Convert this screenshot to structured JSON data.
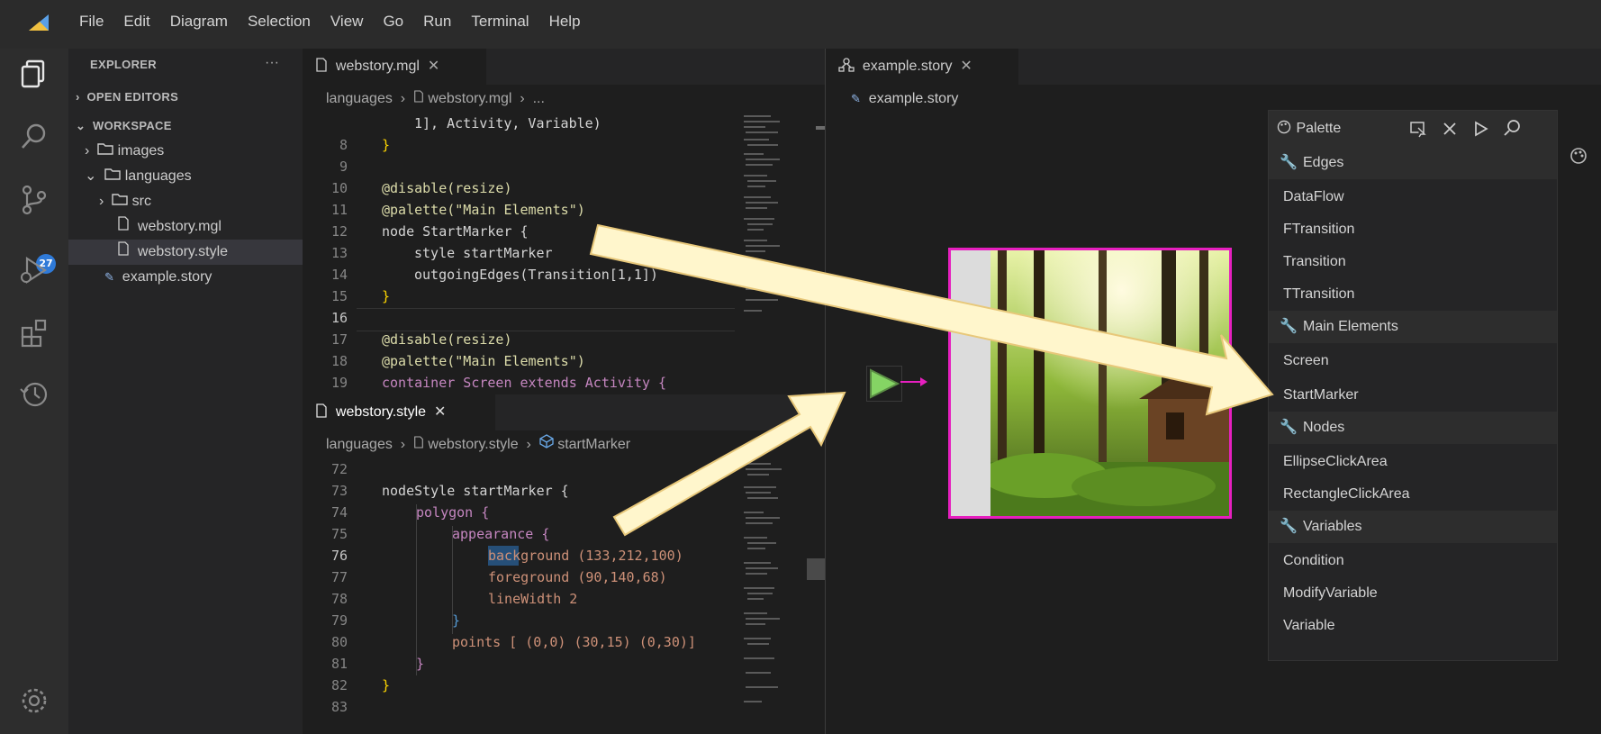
{
  "menu": [
    "File",
    "Edit",
    "Diagram",
    "Selection",
    "View",
    "Go",
    "Run",
    "Terminal",
    "Help"
  ],
  "activity_bar": {
    "scm_badge": "27"
  },
  "explorer": {
    "title": "EXPLORER",
    "more": "···",
    "open_editors": "OPEN EDITORS",
    "workspace": "WORKSPACE",
    "items": [
      {
        "label": "images"
      },
      {
        "label": "languages"
      },
      {
        "label": "src"
      },
      {
        "label": "webstory.mgl"
      },
      {
        "label": "webstory.style"
      },
      {
        "label": "example.story"
      }
    ]
  },
  "editor_top": {
    "tab": "webstory.mgl",
    "breadcrumb": {
      "a": "languages",
      "b": "webstory.mgl",
      "c": "..."
    },
    "lines": [
      {
        "n": "",
        "text": "1], Activity, Variable)"
      },
      {
        "n": "8",
        "text": "}"
      },
      {
        "n": "9",
        "text": ""
      },
      {
        "n": "10",
        "text": "@disable(resize)"
      },
      {
        "n": "11",
        "text": "@palette(\"Main Elements\")"
      },
      {
        "n": "12",
        "text": "node StartMarker {"
      },
      {
        "n": "13",
        "text": "style startMarker"
      },
      {
        "n": "14",
        "text": "outgoingEdges(Transition[1,1])"
      },
      {
        "n": "15",
        "text": "}"
      },
      {
        "n": "16",
        "text": ""
      },
      {
        "n": "17",
        "text": "@disable(resize)"
      },
      {
        "n": "18",
        "text": "@palette(\"Main Elements\")"
      },
      {
        "n": "19",
        "text": "container Screen extends Activity {"
      }
    ]
  },
  "editor_bottom": {
    "tab": "webstory.style",
    "breadcrumb": {
      "a": "languages",
      "b": "webstory.style",
      "c": "startMarker"
    },
    "lines": [
      {
        "n": "72",
        "text": ""
      },
      {
        "n": "73",
        "text": "nodeStyle startMarker {"
      },
      {
        "n": "74",
        "text": "polygon {"
      },
      {
        "n": "75",
        "text": "appearance {"
      },
      {
        "n": "76",
        "text": "background (133,212,100)"
      },
      {
        "n": "77",
        "text": "foreground (90,140,68)"
      },
      {
        "n": "78",
        "text": "lineWidth 2"
      },
      {
        "n": "79",
        "text": "}"
      },
      {
        "n": "80",
        "text": "points [ (0,0) (30,15) (0,30)]"
      },
      {
        "n": "81",
        "text": "}"
      },
      {
        "n": "82",
        "text": "}"
      },
      {
        "n": "83",
        "text": ""
      }
    ]
  },
  "diagram": {
    "tab": "example.story",
    "breadcrumb": "example.story",
    "start_marker_color": "#85d464",
    "screen_border_color": "#e61fbf"
  },
  "palette": {
    "title": "Palette",
    "categories": [
      {
        "name": "Edges",
        "items": [
          "DataFlow",
          "FTransition",
          "Transition",
          "TTransition"
        ]
      },
      {
        "name": "Main Elements",
        "items": [
          "Screen",
          "StartMarker"
        ]
      },
      {
        "name": "Nodes",
        "items": [
          "EllipseClickArea",
          "RectangleClickArea"
        ]
      },
      {
        "name": "Variables",
        "items": [
          "Condition",
          "ModifyVariable",
          "Variable"
        ]
      }
    ]
  },
  "colors": {
    "arrow": "#fff6cc",
    "arrow_stroke": "#e8c87a",
    "accent": "#2f7ad8"
  }
}
